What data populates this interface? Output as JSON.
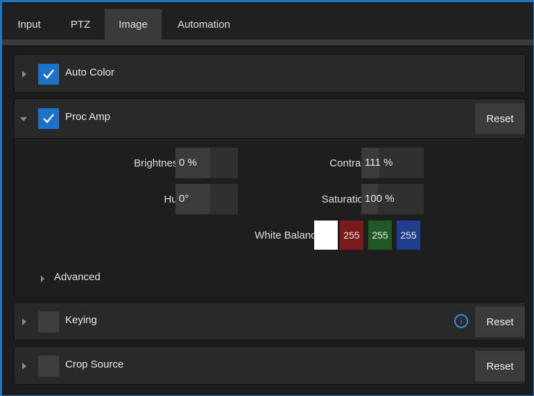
{
  "tabs": [
    {
      "label": "Input"
    },
    {
      "label": "PTZ"
    },
    {
      "label": "Image",
      "active": true
    },
    {
      "label": "Automation"
    }
  ],
  "sections": {
    "auto_color": {
      "title": "Auto Color",
      "checked": true
    },
    "proc_amp": {
      "title": "Proc Amp",
      "checked": true,
      "reset_label": "Reset",
      "brightness": {
        "label": "Brightness",
        "value": "0",
        "unit": "%"
      },
      "contrast": {
        "label": "Contrast",
        "value": "111",
        "unit": "%"
      },
      "hue": {
        "label": "Hue",
        "value": "0°"
      },
      "saturation": {
        "label": "Saturation",
        "value": "100",
        "unit": "%"
      },
      "white_balance": {
        "label": "White Balance",
        "r": "255",
        "g": "255",
        "b": "255",
        "colors": {
          "swatch": "#ffffff",
          "r": "#7a1a1a",
          "g": "#1f5a24",
          "b": "#1f3f8e"
        }
      },
      "advanced_label": "Advanced"
    },
    "keying": {
      "title": "Keying",
      "checked": false,
      "reset_label": "Reset",
      "info_icon": "info-icon"
    },
    "crop_source": {
      "title": "Crop Source",
      "checked": false,
      "reset_label": "Reset"
    }
  },
  "colors": {
    "accent": "#1a73c8",
    "frame": "#1f76c5"
  }
}
